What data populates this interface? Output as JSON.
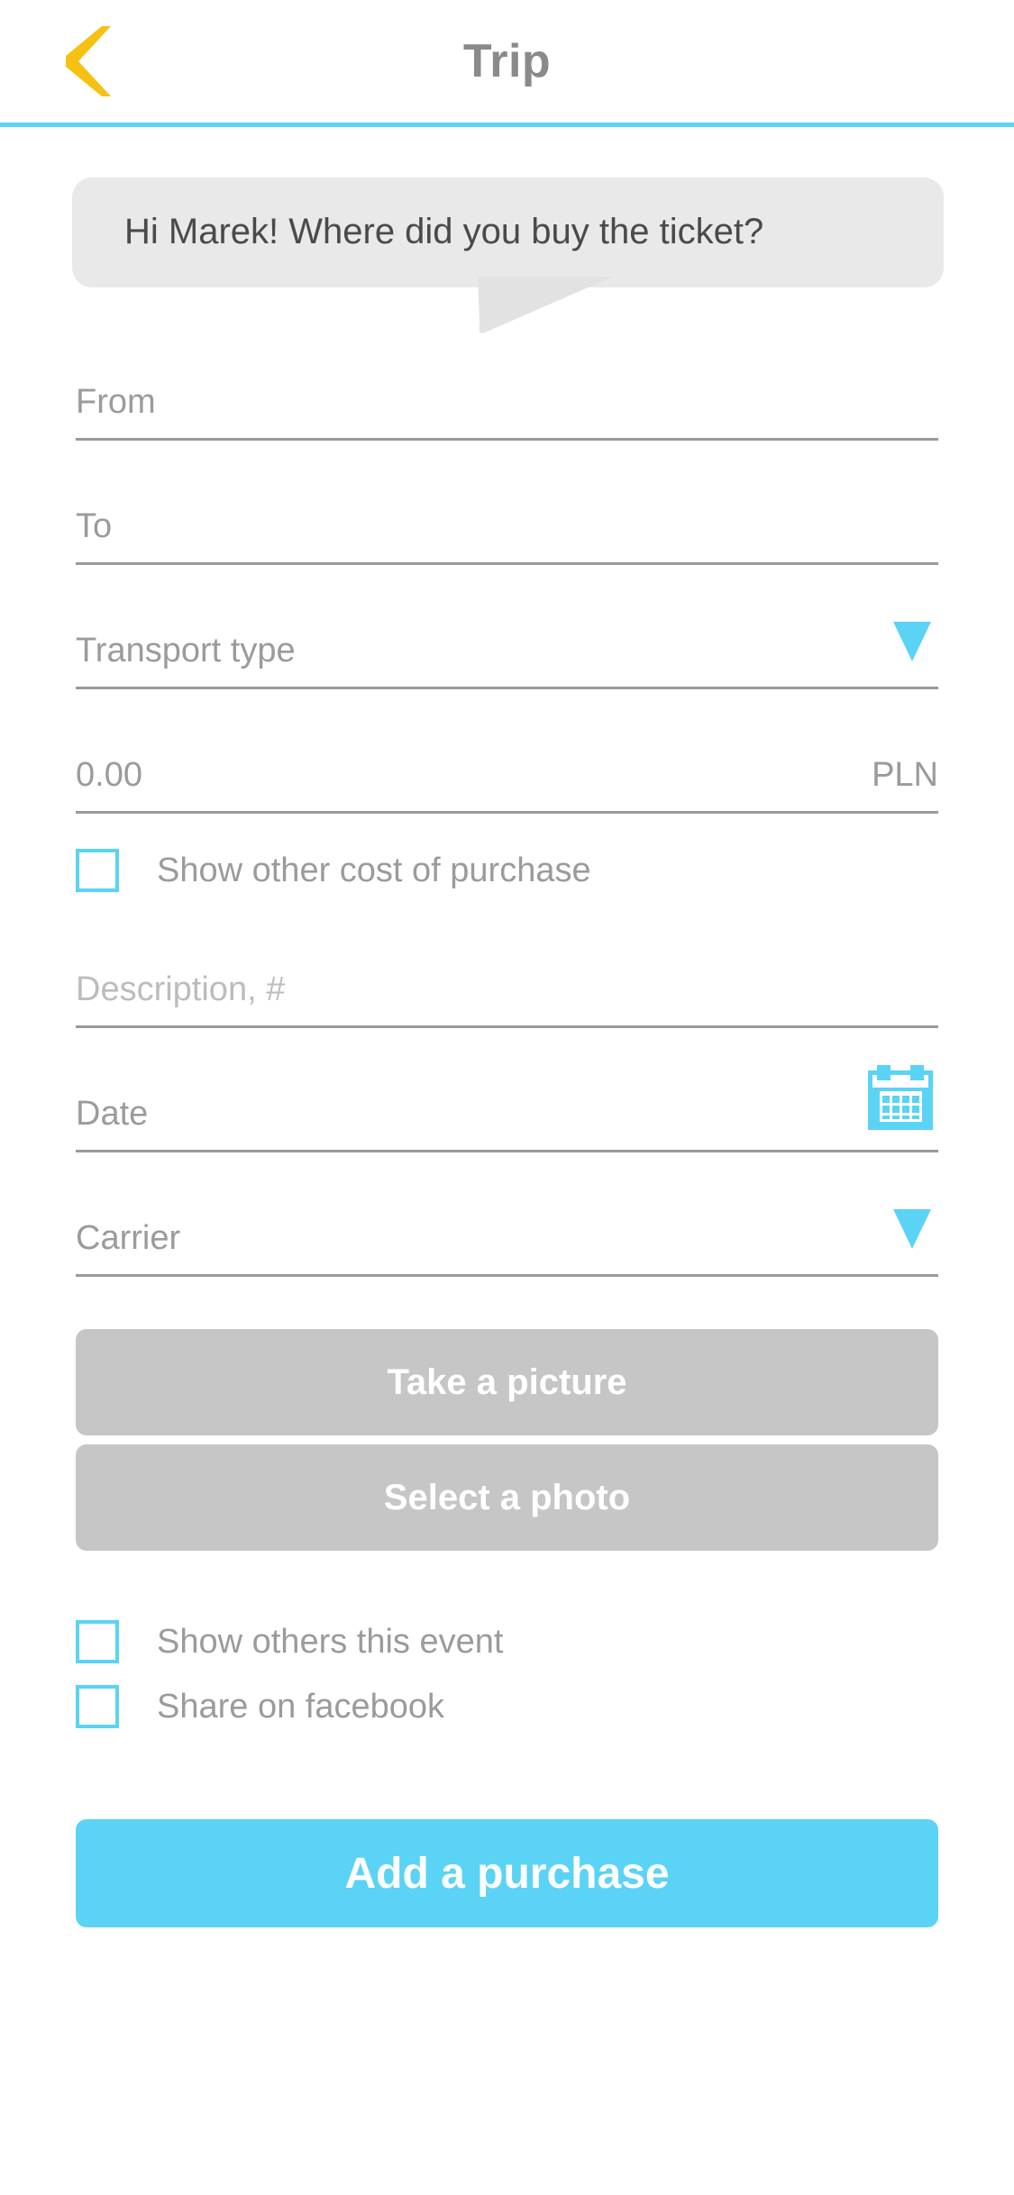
{
  "header": {
    "title": "Trip",
    "back_icon": "chevron-left-icon",
    "back_color": "#f7c113",
    "accent_color": "#5bd3f5"
  },
  "assistant": {
    "message": "Hi Marek! Where did you buy the ticket?",
    "bubble_color": "#e9e9e9"
  },
  "form": {
    "from": {
      "label": "From",
      "value": "",
      "placeholder": "From"
    },
    "to": {
      "label": "To",
      "value": "",
      "placeholder": "To"
    },
    "transport_type": {
      "label": "Transport type",
      "value": "",
      "placeholder": "Transport type",
      "caret_icon": "chevron-down-icon"
    },
    "amount": {
      "label": "0.00",
      "value": "",
      "placeholder": "0.00",
      "currency": "PLN"
    },
    "other_cost": {
      "label": "Show other cost of purchase",
      "checked": false
    },
    "description": {
      "label": "Description, #",
      "value": "",
      "placeholder": "Description, #"
    },
    "date": {
      "label": "Date",
      "value": "",
      "placeholder": "Date",
      "icon": "calendar-icon"
    },
    "carrier": {
      "label": "Carrier",
      "value": "",
      "placeholder": "Carrier",
      "caret_icon": "chevron-down-icon"
    }
  },
  "photo": {
    "take_picture": "Take a picture",
    "select_photo": "Select a photo"
  },
  "sharing": {
    "show_others": {
      "label": "Show others this event",
      "checked": false
    },
    "share_facebook": {
      "label": "Share on facebook",
      "checked": false
    }
  },
  "cta": {
    "label": "Add a purchase",
    "color": "#5bd3f5"
  }
}
